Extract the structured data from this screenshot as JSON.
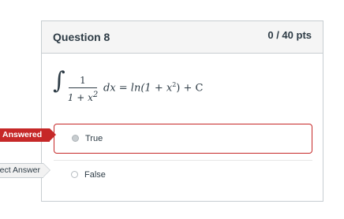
{
  "question": {
    "title": "Question 8",
    "points": "0 / 40 pts",
    "formula": {
      "integral_sign": "∫",
      "numerator": "1",
      "denominator": "1 + x",
      "denominator_exp": "2",
      "rhs_lead": "dx = ln(1 + x",
      "rhs_exp": "2",
      "rhs_tail": ") + C"
    }
  },
  "answers": [
    {
      "label": "True",
      "selected": true
    },
    {
      "label": "False",
      "selected": false
    }
  ],
  "tags": {
    "answered": "Answered",
    "correct_answer": "Correct Answer"
  },
  "colors": {
    "answered_red": "#c62828",
    "border_gray": "#c7cdd1",
    "header_bg": "#f5f5f5",
    "text": "#2d3b45"
  }
}
